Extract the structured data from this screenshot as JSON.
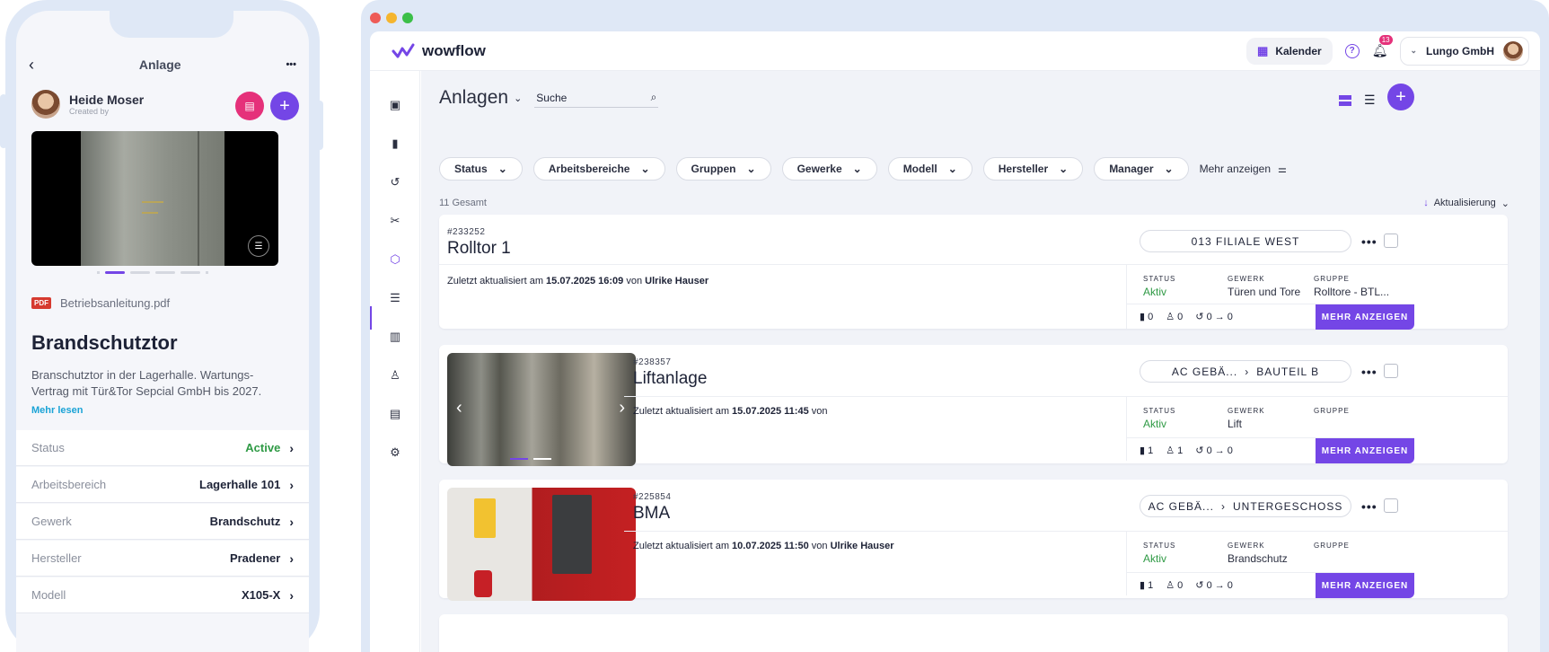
{
  "mobile": {
    "title": "Anlage",
    "more_glyph": "•••",
    "profile": {
      "name": "Heide Moser",
      "caption": "Created by"
    },
    "attachment": {
      "badge": "PDF",
      "file": "Betriebsanleitung.pdf"
    },
    "asset_title": "Brandschutztor",
    "description": "Branschutztor in der Lagerhalle. Wartungs-Vertrag mit Tür&Tor Sepcial GmbH bis 2027.",
    "read_more": "Mehr lesen",
    "rows": [
      {
        "label": "Status",
        "value": "Active"
      },
      {
        "label": "Arbeitsbereich",
        "value": "Lagerhalle 101"
      },
      {
        "label": "Gewerk",
        "value": "Brandschutz"
      },
      {
        "label": "Hersteller",
        "value": "Pradener"
      },
      {
        "label": "Modell",
        "value": "X105-X"
      }
    ]
  },
  "app": {
    "logo": "wowflow",
    "calendar": "Kalender",
    "notifications": "13",
    "account": "Lungo GmbH",
    "page_title": "Anlagen",
    "search": "Suche",
    "filters": [
      "Status",
      "Arbeitsbereiche",
      "Gruppen",
      "Gewerke",
      "Modell",
      "Hersteller",
      "Manager"
    ],
    "more_filters": "Mehr anzeigen",
    "total": "11 Gesamt",
    "sort": "Aktualisierung",
    "meta_labels": {
      "status": "STATUS",
      "gewerk": "GEWERK",
      "gruppe": "GRUPPE"
    },
    "button": "MEHR ANZEIGEN",
    "cards": [
      {
        "id": "#233252",
        "name": "Rolltor 1",
        "location": "013 FILIALE WEST",
        "location_sub": "",
        "updated_prefix": "Zuletzt aktualisiert am",
        "updated_at": "15.07.2025 16:09",
        "by_word": "von",
        "updated_by": "Ulrike Hauser",
        "status": "Aktiv",
        "gewerk": "Türen und Tore",
        "gruppe": "Rolltore - BTL...",
        "docs": "0",
        "people": "0",
        "history": "0 → 0"
      },
      {
        "id": "#238357",
        "name": "Liftanlage",
        "location": "AC GEBÄ...",
        "location_sub": "BAUTEIL B",
        "updated_prefix": "Zuletzt aktualisiert am",
        "updated_at": "15.07.2025 11:45",
        "by_word": "von",
        "updated_by": "",
        "status": "Aktiv",
        "gewerk": "Lift",
        "gruppe": "",
        "docs": "1",
        "people": "1",
        "history": "0 → 0"
      },
      {
        "id": "#225854",
        "name": "BMA",
        "location": "AC GEBÄ...",
        "location_sub": "UNTERGESCHOSS",
        "updated_prefix": "Zuletzt aktualisiert am",
        "updated_at": "10.07.2025 11:50",
        "by_word": "von",
        "updated_by": "Ulrike Hauser",
        "status": "Aktiv",
        "gewerk": "Brandschutz",
        "gruppe": "",
        "docs": "1",
        "people": "0",
        "history": "0 → 0"
      }
    ]
  },
  "colors": {
    "accent": "#7446e6",
    "pink": "#e5317a",
    "success": "#2f9a45",
    "link": "#1aa3d6"
  }
}
